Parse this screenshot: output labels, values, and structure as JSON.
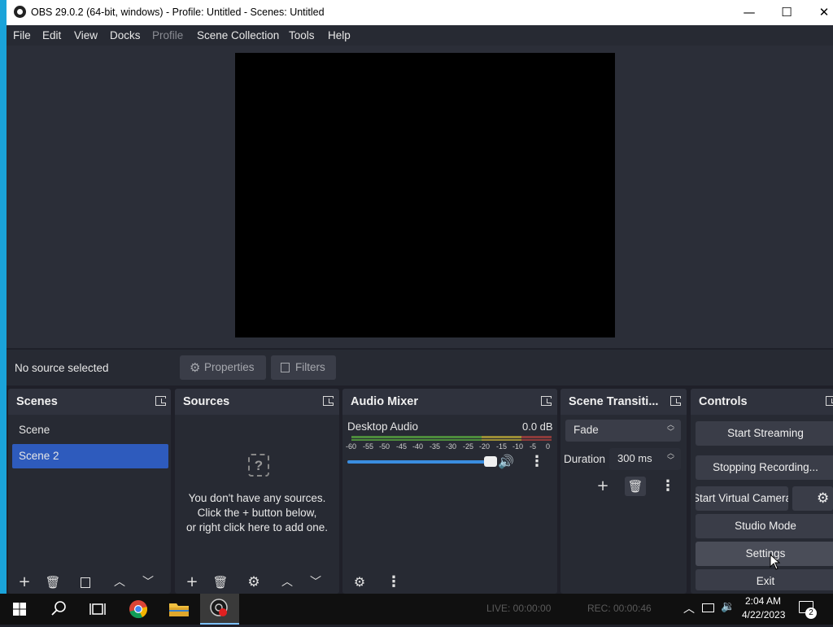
{
  "window": {
    "title": "OBS 29.0.2 (64-bit, windows) - Profile: Untitled - Scenes: Untitled",
    "minimize": "—",
    "maximize": "☐",
    "close": "✕"
  },
  "menu": [
    "File",
    "Edit",
    "View",
    "Docks",
    "Profile",
    "Scene Collection",
    "Tools",
    "Help"
  ],
  "source_toolbar": {
    "status": "No source selected",
    "properties": "Properties",
    "filters": "Filters"
  },
  "scenes": {
    "title": "Scenes",
    "items": [
      "Scene",
      "Scene 2"
    ],
    "selected_index": 1
  },
  "sources": {
    "title": "Sources",
    "empty_line1": "You don't have any sources.",
    "empty_line2": "Click the + button below,",
    "empty_line3": "or right click here to add one."
  },
  "audio_mixer": {
    "title": "Audio Mixer",
    "channel": "Desktop Audio",
    "level": "0.0 dB",
    "ticks": [
      "-60",
      "-55",
      "-50",
      "-45",
      "-40",
      "-35",
      "-30",
      "-25",
      "-20",
      "-15",
      "-10",
      "-5",
      "0"
    ],
    "volume_fraction": 1.0
  },
  "transitions": {
    "title": "Scene Transiti...",
    "selected": "Fade",
    "duration_label": "Duration",
    "duration_value": "300 ms"
  },
  "controls": {
    "title": "Controls",
    "start_streaming": "Start Streaming",
    "stopping_recording": "Stopping Recording...",
    "virtual_camera": "Start Virtual Camera",
    "studio_mode": "Studio Mode",
    "settings": "Settings",
    "exit": "Exit"
  },
  "statusbar": {
    "live": "LIVE: 00:00:00",
    "rec": "REC: 00:00:46"
  },
  "taskbar": {
    "time": "2:04 AM",
    "date": "4/22/2023",
    "notifications": "2"
  },
  "colors": {
    "selected_scene": "#2e5bbd",
    "volume_fill": "#3a8de0",
    "desktop_strip": "#1aa3d9"
  }
}
